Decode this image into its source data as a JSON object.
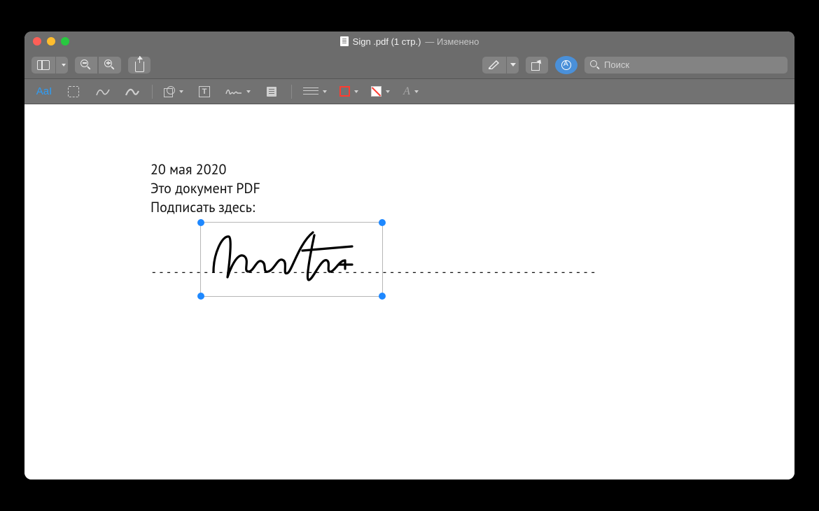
{
  "window": {
    "title_filename": "Sign .pdf (1 стр.)",
    "title_status_separator": " — ",
    "title_status": "Изменено"
  },
  "toolbar": {
    "search_placeholder": "Поиск"
  },
  "markup": {
    "text_tool_label": "AaI",
    "text_box_glyph": "T",
    "font_style_glyph": "A"
  },
  "document": {
    "line1": "20 мая 2020",
    "line2": "Это документ PDF",
    "line3": "Подписать здесь:",
    "signature_rule": "------------------------------------------------------------"
  }
}
